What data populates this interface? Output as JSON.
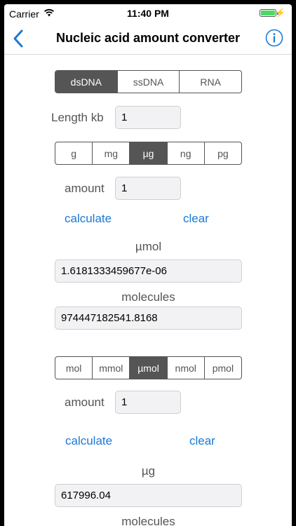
{
  "status": {
    "carrier": "Carrier",
    "time": "11:40 PM"
  },
  "nav": {
    "title": "Nucleic acid amount converter"
  },
  "colors": {
    "accent": "#1a7ad6",
    "selected_segment": "#555555",
    "battery": "#4cd964"
  },
  "type_segment": {
    "options": [
      "dsDNA",
      "ssDNA",
      "RNA"
    ],
    "selected": "dsDNA"
  },
  "length": {
    "label": "Length kb",
    "value": "1"
  },
  "mass_units": {
    "options": [
      "g",
      "mg",
      "µg",
      "ng",
      "pg"
    ],
    "selected": "µg"
  },
  "section1": {
    "amount_label": "amount",
    "amount_value": "1",
    "calculate": "calculate",
    "clear": "clear",
    "result1_label": "µmol",
    "result1_value": "1.6181333459677e-06",
    "result2_label": "molecules",
    "result2_value": "974447182541.8168"
  },
  "mole_units": {
    "options": [
      "mol",
      "mmol",
      "µmol",
      "nmol",
      "pmol"
    ],
    "selected": "µmol"
  },
  "section2": {
    "amount_label": "amount",
    "amount_value": "1",
    "calculate": "calculate",
    "clear": "clear",
    "result1_label": "µg",
    "result1_value": "617996.04",
    "result2_label": "molecules"
  }
}
